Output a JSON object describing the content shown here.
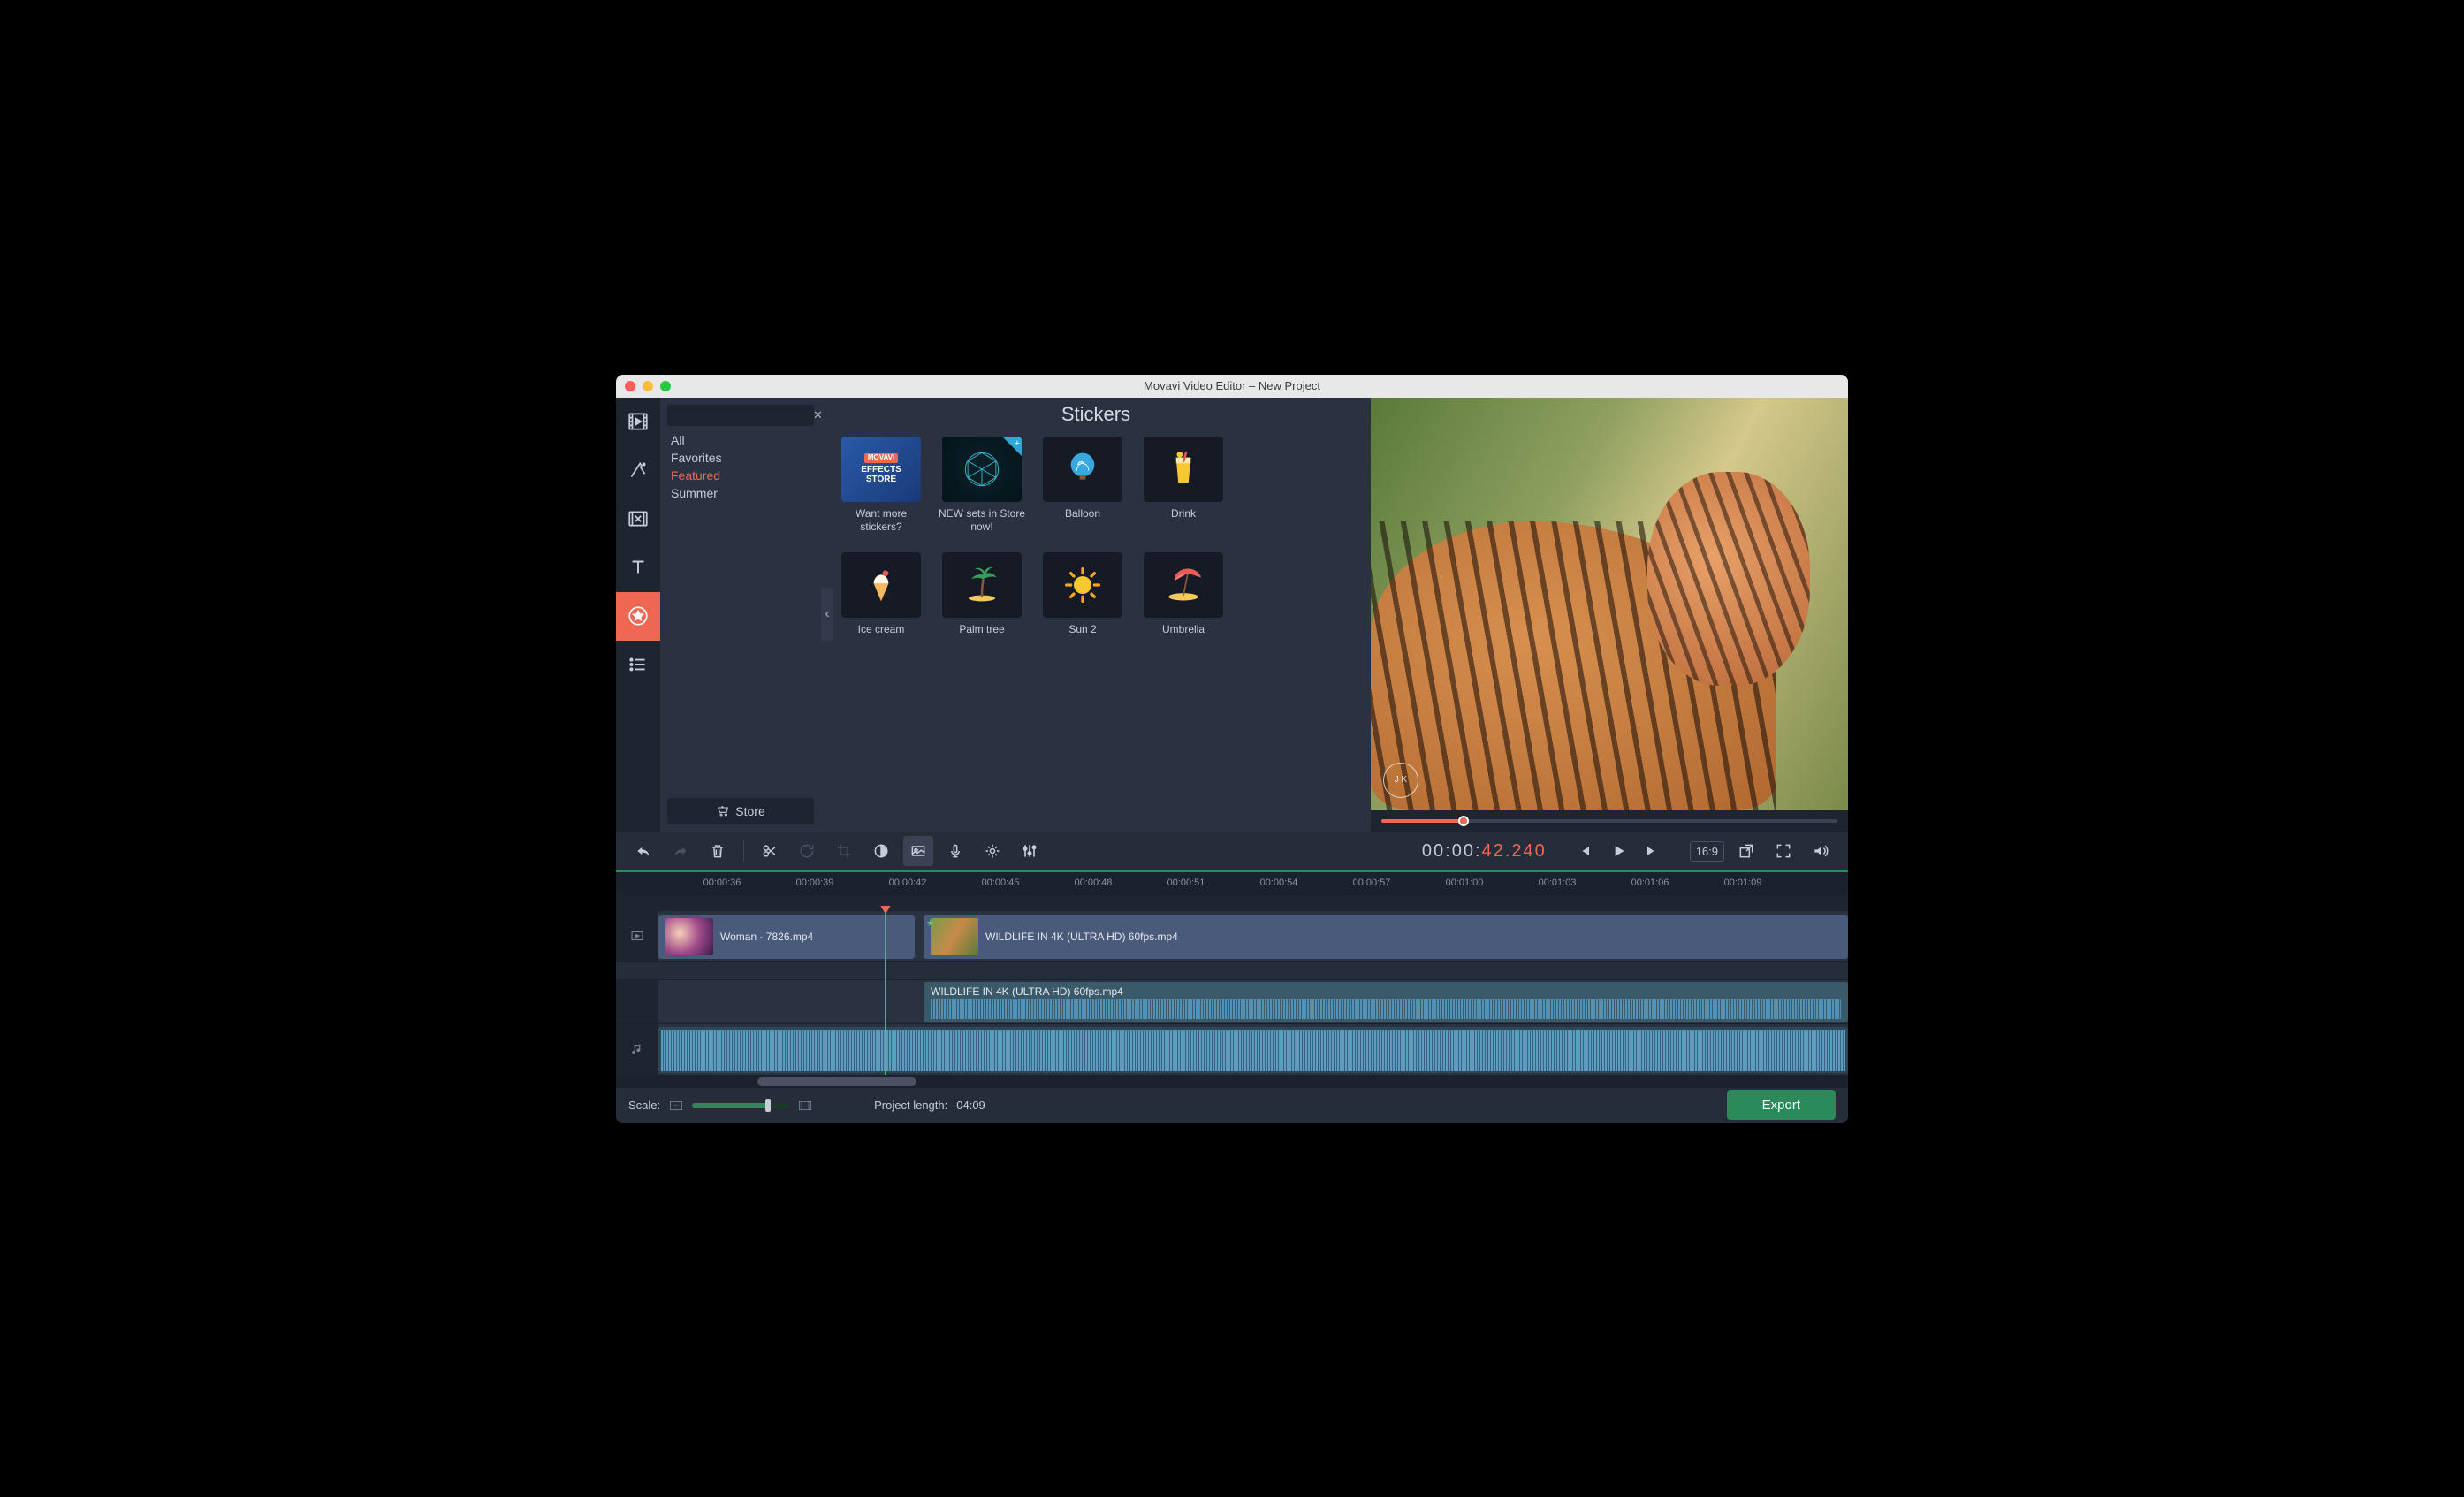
{
  "window": {
    "title": "Movavi Video Editor – New Project"
  },
  "rail": [
    "media",
    "filters",
    "transitions",
    "titles",
    "stickers",
    "more"
  ],
  "categories": {
    "items": [
      "All",
      "Favorites",
      "Featured",
      "Summer"
    ],
    "selected": "Featured",
    "store_label": "Store"
  },
  "stickers": {
    "heading": "Stickers",
    "tiles": [
      {
        "label": "Want more stickers?",
        "kind": "store"
      },
      {
        "label": "NEW sets in Store now!",
        "kind": "geo",
        "badge": true
      },
      {
        "label": "Balloon",
        "kind": "balloon"
      },
      {
        "label": "Drink",
        "kind": "drink"
      },
      {
        "label": "Ice cream",
        "kind": "ice"
      },
      {
        "label": "Palm tree",
        "kind": "palm"
      },
      {
        "label": "Sun 2",
        "kind": "sun"
      },
      {
        "label": "Umbrella",
        "kind": "umb"
      }
    ]
  },
  "preview": {
    "watermark": "J K"
  },
  "timecode": {
    "grey": "00:00:",
    "orange": "42.240"
  },
  "aspect": "16:9",
  "ruler": [
    "00:00:36",
    "00:00:39",
    "00:00:42",
    "00:00:45",
    "00:00:48",
    "00:00:51",
    "00:00:54",
    "00:00:57",
    "00:01:00",
    "00:01:03",
    "00:01:06",
    "00:01:09"
  ],
  "clips": {
    "video1": "Woman - 7826.mp4",
    "video2": "WILDLIFE IN 4K (ULTRA HD) 60fps.mp4",
    "audio1": "WILDLIFE IN 4K (ULTRA HD) 60fps.mp4"
  },
  "footer": {
    "scale_label": "Scale:",
    "project_len_label": "Project length:",
    "project_len_value": "04:09",
    "export": "Export"
  }
}
